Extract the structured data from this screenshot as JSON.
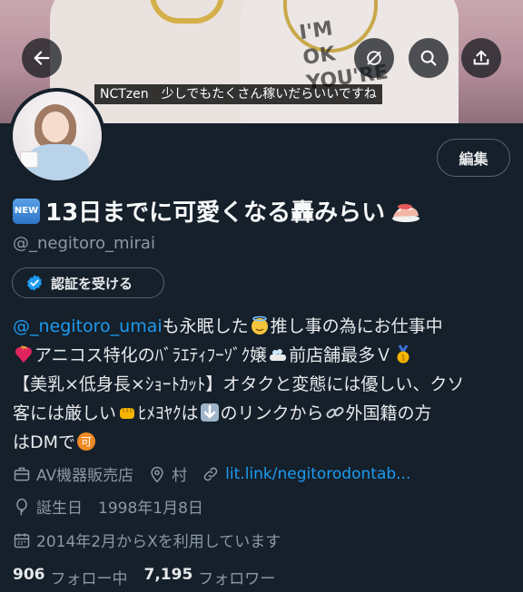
{
  "banner": {
    "caption": "NCTzen　少しでもたくさん稼いだらいいですね",
    "shirt_print": "I'M OK YOU'RE"
  },
  "header_buttons": {
    "back": "back-arrow-icon",
    "edit_image": "image-off-icon",
    "search": "search-icon",
    "share": "share-icon"
  },
  "profile": {
    "edit_label": "編集",
    "new_badge": "NEW",
    "display_name": "13日までに可愛くなる轟みらい",
    "handle": "@_negitoro_mirai",
    "verify_label": "認証を受ける"
  },
  "bio": {
    "line1_link": "@_negitoro_umai",
    "line1_text": "も永眠した",
    "line1_text2": "推し事の為にお仕事中",
    "line2_text": "アニコス特化のﾊﾞﾗｴﾃｨﾌｰｿﾞｸ嬢",
    "line2_text2": "前店舗最多Ｖ",
    "line3_text": "【美乳×低身長×ｼｮｰﾄｶｯﾄ】オタクと変態には優しい、クソ",
    "line4_text": "客には厳しい",
    "line4_text2": "ﾋﾒﾖﾔｸは",
    "line4_text3": "のリンクから",
    "line4_text4": "外国籍の方",
    "line5_text": "はDMで"
  },
  "meta": {
    "category": "AV機器販売店",
    "location": "村",
    "url": "lit.link/negitorodontab...",
    "birthday": "誕生日　1998年1月8日",
    "joined": "2014年2月からXを利用しています"
  },
  "stats": {
    "following_count": "906",
    "following_label": "フォロー中",
    "followers_count": "7,195",
    "followers_label": "フォロワー"
  },
  "colors": {
    "background": "#15202b",
    "text": "#e7e9ea",
    "secondary": "#8b98a5",
    "link": "#1d9bf0",
    "border": "#536471"
  }
}
